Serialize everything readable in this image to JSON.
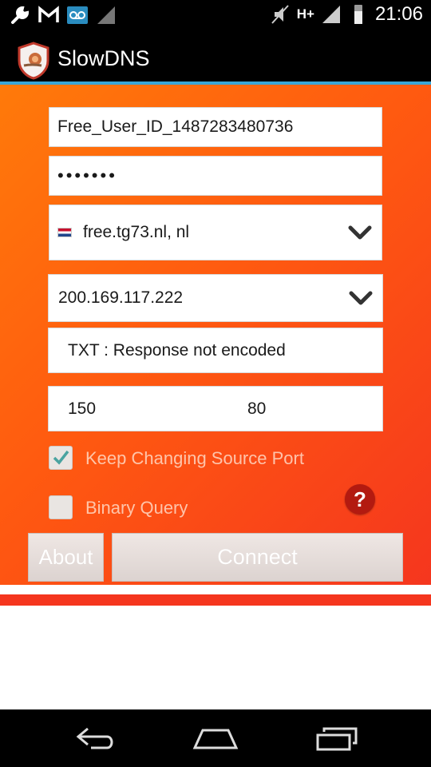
{
  "status_bar": {
    "time": "21:06",
    "network_label": "H+",
    "icons": [
      "wrench-icon",
      "gmail-icon",
      "voicemail-icon",
      "signal-icon",
      "mute-icon",
      "signal-icon",
      "battery-icon"
    ]
  },
  "app": {
    "title": "SlowDNS",
    "logo_icon": "snail-shield-icon"
  },
  "form": {
    "user_id": "Free_User_ID_1487283480736",
    "password_masked": "•••••••",
    "server": {
      "flag_icon": "netherlands-flag-icon",
      "value": "free.tg73.nl, nl"
    },
    "dns_ip": "200.169.117.222",
    "mode": "TXT : Response not encoded",
    "port_a": "150",
    "port_b": "80",
    "keep_changing_port": {
      "label": "Keep Changing Source Port",
      "checked": true
    },
    "binary_query": {
      "label": "Binary Query",
      "checked": false
    },
    "help_label": "?"
  },
  "buttons": {
    "about": "About",
    "connect": "Connect"
  },
  "colors": {
    "accent": "#3aa6d6",
    "background_start": "#ff7a0a",
    "background_end": "#f5361e",
    "help": "#b31a10"
  },
  "nav_bar": {
    "icons": [
      "back-icon",
      "home-icon",
      "recents-icon"
    ]
  }
}
